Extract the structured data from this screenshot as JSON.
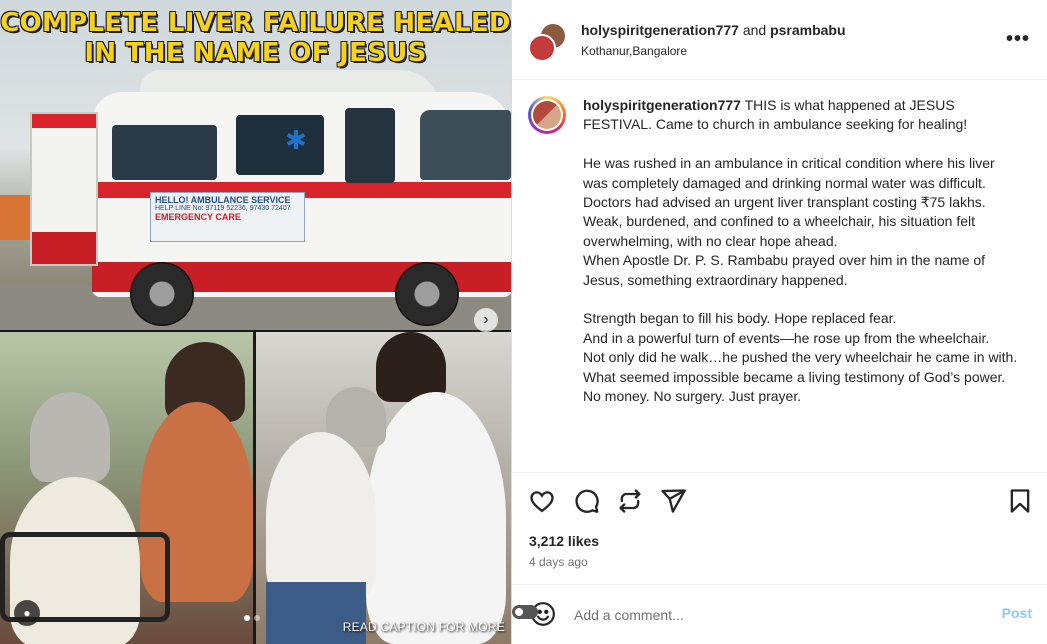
{
  "media": {
    "headline_line1": "COMPLETE LIVER FAILURE HEALED",
    "headline_line2": "IN THE NAME OF JESUS",
    "ambulance_sign": "HELLO! AMBULANCE SERVICE",
    "ambulance_helpline": "HELP LINE No: 97119 52236, 97430 72407",
    "ambulance_emergency": "EMERGENCY CARE",
    "overlay_caption": "READ CAPTION FOR MORE",
    "next_icon": "chevron-right-icon",
    "user_tag_icon": "person-icon",
    "carousel_count": 2,
    "carousel_active": 1
  },
  "header": {
    "user1": "holyspiritgeneration777",
    "joiner": " and ",
    "user2": "psrambabu",
    "location": "Kothanur,Bangalore",
    "more_icon": "•••"
  },
  "caption": {
    "username": "holyspiritgeneration777",
    "intro": " THIS is what happened at JESUS FESTIVAL. Came to church in ambulance seeking for healing!",
    "p1": "He was rushed in an ambulance in critical condition where his liver was completely damaged and drinking normal water was difficult. Doctors had advised an urgent liver transplant costing ₹75 lakhs.",
    "p2": "Weak, burdened, and confined to a wheelchair, his situation felt overwhelming, with no clear hope ahead.",
    "p3": "When Apostle Dr. P. S. Rambabu prayed over him in the name of Jesus, something extraordinary happened.",
    "p4": "Strength began to fill his body. Hope replaced fear.",
    "p5": "And in a powerful turn of events—he rose up from the wheelchair.",
    "p6": "Not only did he walk…he pushed the very wheelchair he came in with.",
    "p7": "What seemed impossible became a living testimony of God’s power.",
    "p8": "No money. No surgery. Just prayer."
  },
  "actions": {
    "like_icon": "heart-icon",
    "comment_icon": "comment-icon",
    "share_icon": "repost-icon",
    "send_icon": "send-icon",
    "save_icon": "bookmark-icon",
    "likes": "3,212 likes",
    "time_ago": "4 days ago"
  },
  "comment": {
    "placeholder": "Add a comment...",
    "post_label": "Post",
    "emoji_icon": "emoji-icon"
  },
  "colors": {
    "headline": "#f7d21a",
    "post_button": "#8fc7f4",
    "text": "#262626",
    "secondary": "#737373"
  }
}
